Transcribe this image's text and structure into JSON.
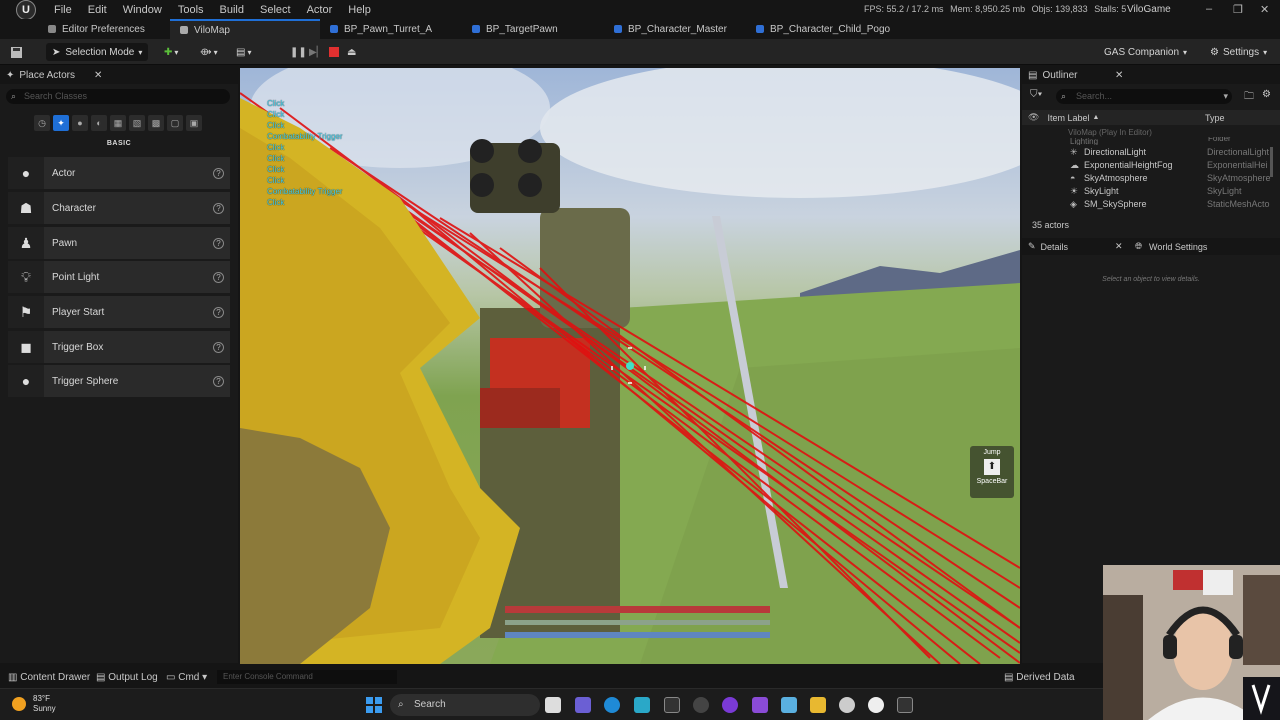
{
  "menu": [
    "File",
    "Edit",
    "Window",
    "Tools",
    "Build",
    "Select",
    "Actor",
    "Help"
  ],
  "perf": {
    "fps": "FPS: 55.2",
    "ms": "17.2 ms",
    "mem": "Mem: 8,950.25 mb",
    "objs": "Objs: 139,833",
    "stalls": "Stalls: 5"
  },
  "app_name": "ViloGame",
  "window_controls": {
    "minimize": "–",
    "restore": "❐",
    "close": "✕"
  },
  "tabs": [
    {
      "label": "Editor Preferences"
    },
    {
      "label": "ViloMap"
    },
    {
      "label": "BP_Pawn_Turret_A"
    },
    {
      "label": "BP_TargetPawn"
    },
    {
      "label": "BP_Character_Master"
    },
    {
      "label": "BP_Character_Child_Pogo"
    }
  ],
  "toolbar": {
    "selection_mode": "Selection Mode",
    "gas_companion": "GAS Companion",
    "settings": "Settings"
  },
  "place_actors": {
    "title": "Place Actors",
    "search_placeholder": "Search Classes",
    "category": "BASIC",
    "items": [
      {
        "label": "Actor",
        "icon": "sphere-icon"
      },
      {
        "label": "Character",
        "icon": "character-icon"
      },
      {
        "label": "Pawn",
        "icon": "pawn-icon"
      },
      {
        "label": "Point Light",
        "icon": "bulb-icon"
      },
      {
        "label": "Player Start",
        "icon": "flag-icon"
      },
      {
        "label": "Trigger Box",
        "icon": "box-icon"
      },
      {
        "label": "Trigger Sphere",
        "icon": "sphere-icon"
      }
    ]
  },
  "viewport": {
    "debug_text": [
      "Click",
      "Click",
      "Click",
      "Combatability Trigger",
      "Click",
      "Click",
      "Click",
      "Click",
      "Combatability Trigger",
      "Click"
    ],
    "jump_label": "Jump",
    "jump_key": "SpaceBar"
  },
  "outliner": {
    "title": "Outliner",
    "search_placeholder": "Search...",
    "col_label": "Item Label",
    "col_type": "Type",
    "root": "ViloMap (Play In Editor)",
    "folder": {
      "name": "Lighting",
      "type": "Folder"
    },
    "rows": [
      {
        "label": "DirectionalLight",
        "type": "DirectionalLight"
      },
      {
        "label": "ExponentialHeightFog",
        "type": "ExponentialHei"
      },
      {
        "label": "SkyAtmosphere",
        "type": "SkyAtmosphere"
      },
      {
        "label": "SkyLight",
        "type": "SkyLight"
      },
      {
        "label": "SM_SkySphere",
        "type": "StaticMeshActo"
      }
    ],
    "count": "35 actors"
  },
  "details": {
    "tab": "Details",
    "world_settings": "World Settings",
    "empty_msg": "Select an object to view details."
  },
  "statusbar": {
    "content_drawer": "Content Drawer",
    "output_log": "Output Log",
    "cmd": "Cmd",
    "console_placeholder": "Enter Console Command",
    "derived_data": "Derived Data"
  },
  "taskbar": {
    "temp": "83°F",
    "weather": "Sunny",
    "search": "Search"
  }
}
